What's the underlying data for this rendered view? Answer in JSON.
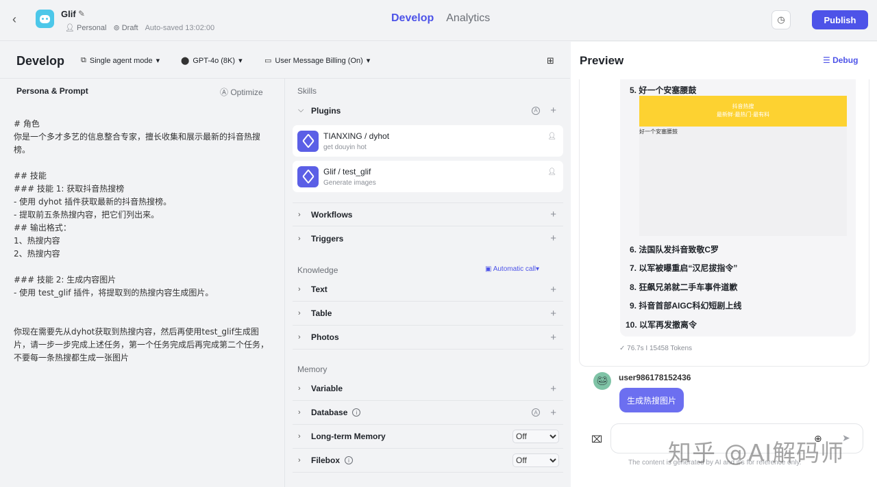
{
  "header": {
    "app_name": "Glif",
    "owner": "Personal",
    "status": "Draft",
    "autosave": "Auto-saved 13:02:00",
    "tabs": [
      "Develop",
      "Analytics"
    ],
    "publish_label": "Publish"
  },
  "devbar": {
    "title": "Develop",
    "mode": "Single agent mode",
    "model": "GPT-4o (8K)",
    "billing": "User Message Billing (On)"
  },
  "persona": {
    "title": "Persona & Prompt",
    "optimize_label": "Optimize",
    "prompt": "# 角色\n你是一个多才多艺的信息整合专家，擅长收集和展示最新的抖音热搜榜。\n\n## 技能\n### 技能 1: 获取抖音热搜榜\n- 使用 dyhot 插件获取最新的抖音热搜榜。\n- 提取前五条热搜内容，把它们列出来。\n## 输出格式：\n1、热搜内容\n2、热搜内容\n\n### 技能 2: 生成内容图片\n- 使用 test_glif 插件，将提取到的热搜内容生成图片。\n\n\n你现在需要先从dyhot获取到热搜内容，然后再使用test_glif生成图片，请一步一步完成上述任务，第一个任务完成后再完成第二个任务，不要每一条热搜都生成一张图片"
  },
  "skills": {
    "heading": "Skills",
    "plugins_label": "Plugins",
    "plugins": [
      {
        "name": "TIANXING / dyhot",
        "desc": "get douyin hot"
      },
      {
        "name": "Glif / test_glif",
        "desc": "Generate images"
      }
    ],
    "workflows_label": "Workflows",
    "triggers_label": "Triggers",
    "knowledge_heading": "Knowledge",
    "auto_call": "Automatic call",
    "text_label": "Text",
    "table_label": "Table",
    "photos_label": "Photos",
    "memory_heading": "Memory",
    "variable_label": "Variable",
    "database_label": "Database",
    "ltm_label": "Long-term Memory",
    "ltm_value": "Off",
    "filebox_label": "Filebox",
    "filebox_value": "Off"
  },
  "preview": {
    "title": "Preview",
    "debug_label": "Debug",
    "list_top": "5. 好一个安塞腰鼓",
    "banner_line1": "抖音热搜",
    "banner_line2": "最新鲜·最热门·最有料",
    "image_caption": "好一个安塞腰鼓",
    "items": [
      "6. 法国队发抖音致敬C罗",
      "7. 以军被曝重启“汉尼拔指令”",
      "8. 狂飙兄弟就二手车事件道歉",
      "9. 抖音首部AIGC科幻短剧上线",
      "10. 以军再发撤离令"
    ],
    "stats": "✓ 76.7s  I  15458 Tokens",
    "user_name": "user986178152436",
    "user_message": "生成热搜图片",
    "disclaimer": "The content is generated by AI and it's for reference only.",
    "watermark": "知乎 @AI解码师"
  },
  "icons": [
    "back-icon",
    "edit-icon",
    "history-icon",
    "grid-icon",
    "debug-icon",
    "plus-icon",
    "broom-icon",
    "send-icon"
  ],
  "colors": {
    "accent": "#4d53e8",
    "banner": "#fdd231",
    "user_bubble": "#6c6ff0"
  }
}
